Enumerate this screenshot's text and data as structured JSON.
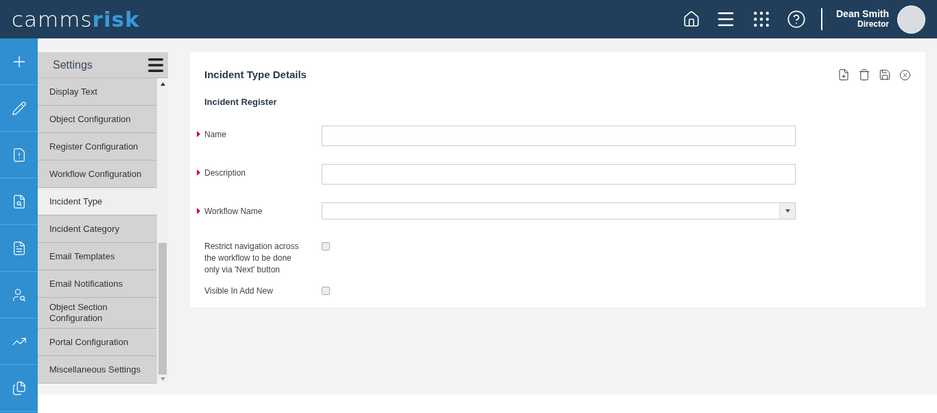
{
  "header": {
    "logo": {
      "part_1": "camms",
      "part_2": "risk"
    },
    "user": {
      "name": "Dean Smith",
      "role": "Director"
    }
  },
  "settings_panel": {
    "title": "Settings",
    "items": [
      {
        "label": "Display Text",
        "selected": false
      },
      {
        "label": "Object Configuration",
        "selected": false
      },
      {
        "label": "Register Configuration",
        "selected": false
      },
      {
        "label": "Workflow Configuration",
        "selected": false
      },
      {
        "label": "Incident Type",
        "selected": true
      },
      {
        "label": "Incident Category",
        "selected": false
      },
      {
        "label": "Email Templates",
        "selected": false
      },
      {
        "label": "Email Notifications",
        "selected": false
      },
      {
        "label": "Object Section Configuration",
        "selected": false
      },
      {
        "label": "Portal Configuration",
        "selected": false
      },
      {
        "label": "Miscellaneous Settings",
        "selected": false
      }
    ]
  },
  "details": {
    "title": "Incident Type Details",
    "subtitle": "Incident Register",
    "fields": [
      {
        "kind": "text",
        "label": "Name",
        "required": true
      },
      {
        "kind": "text",
        "label": "Description",
        "required": true
      },
      {
        "kind": "select",
        "label": "Workflow Name",
        "required": true
      },
      {
        "kind": "checkbox",
        "label": "Restrict navigation across the workflow to be done only via 'Next' button",
        "required": false,
        "checked": false
      },
      {
        "kind": "checkbox",
        "label": "Visible In Add New",
        "required": false,
        "checked": false
      }
    ]
  }
}
